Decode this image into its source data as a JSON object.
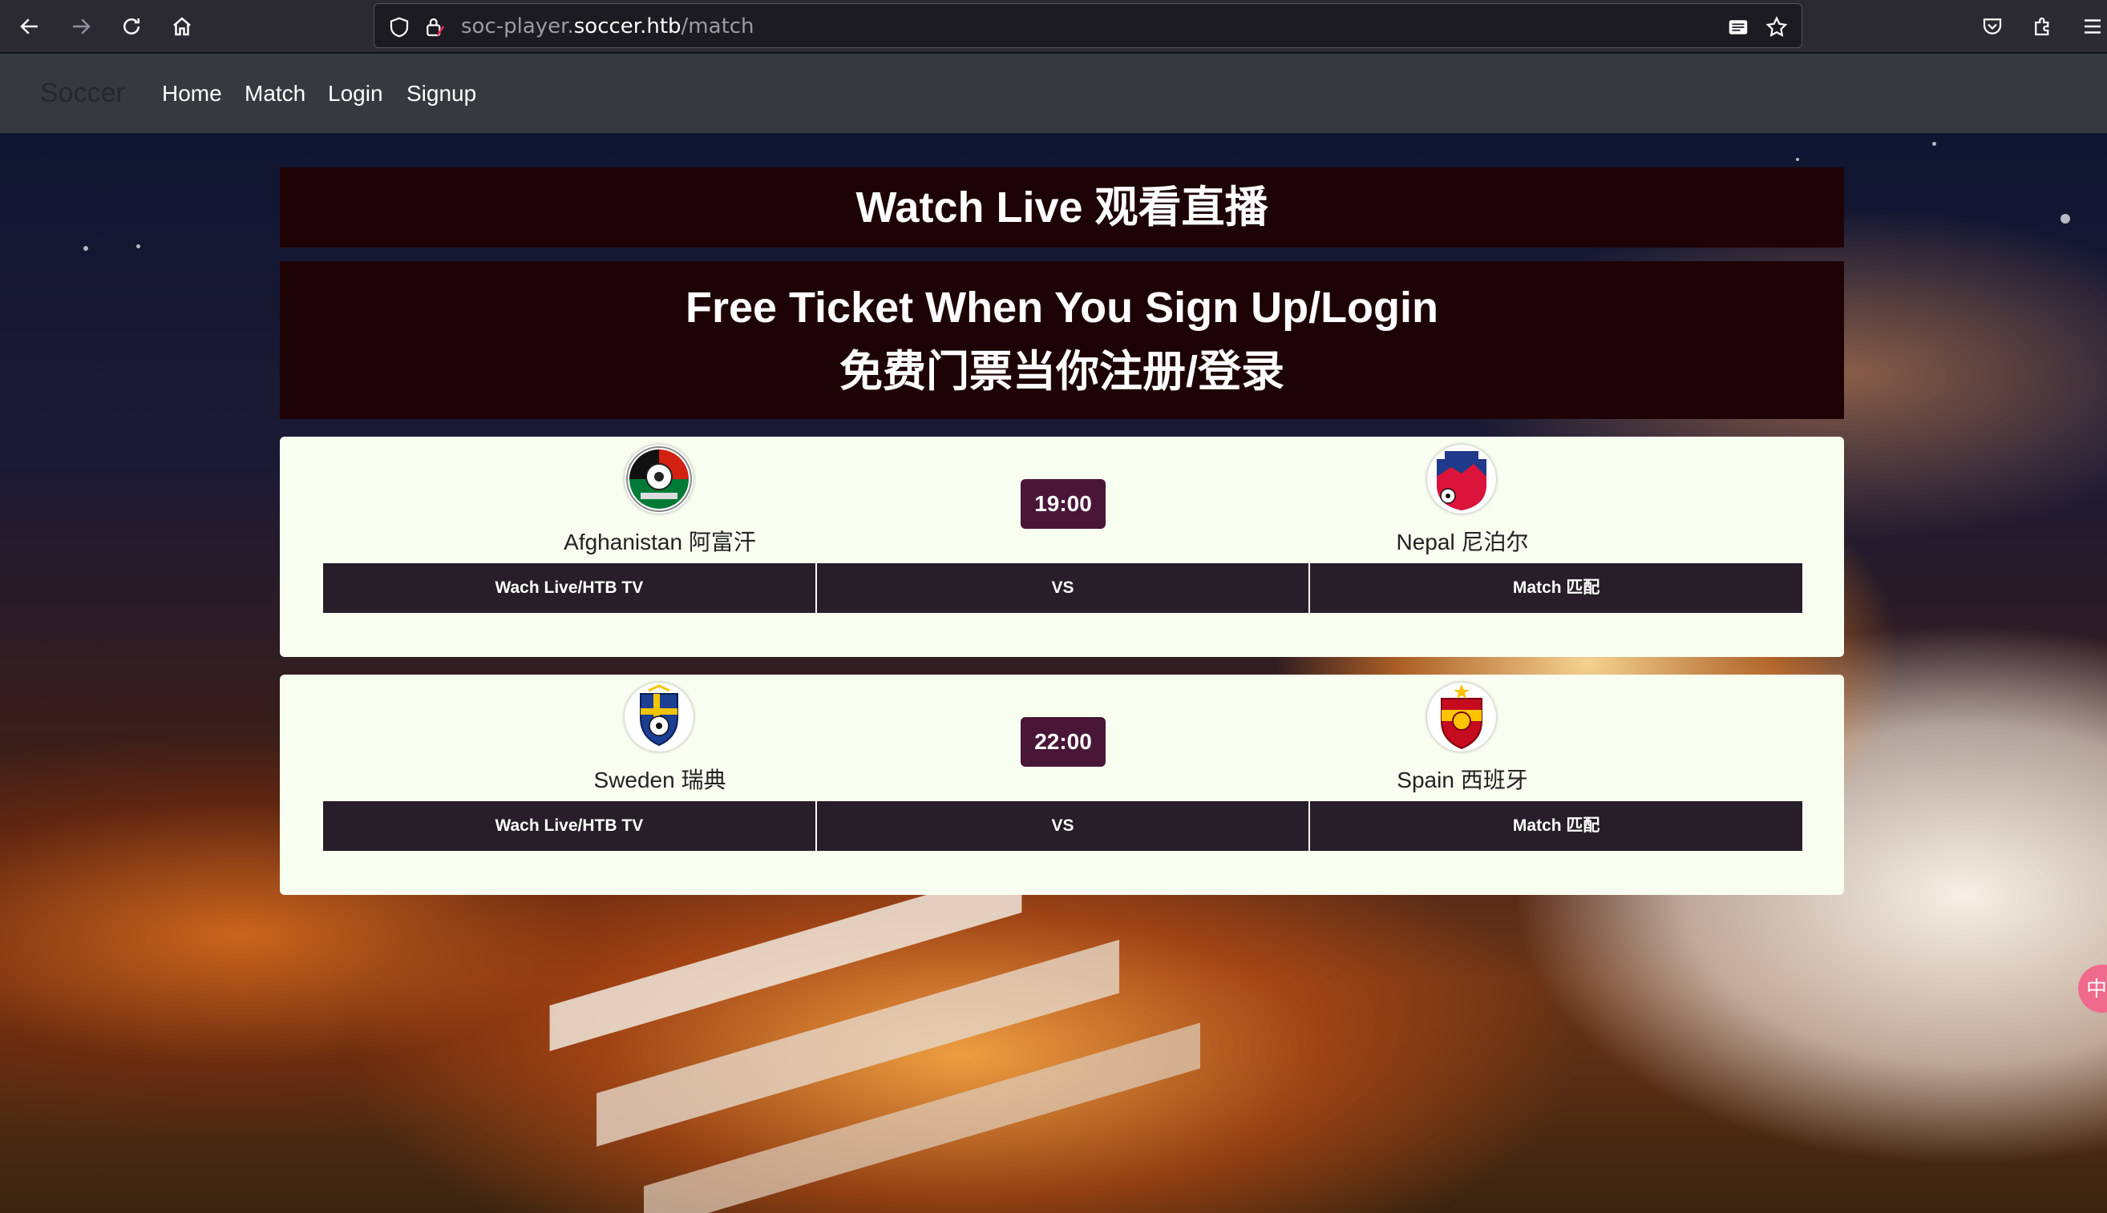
{
  "browser": {
    "url_prefix": "soc-player.",
    "url_domain": "soccer.htb",
    "url_path": "/match"
  },
  "navbar": {
    "brand": "Soccer",
    "links": [
      "Home",
      "Match",
      "Login",
      "Signup"
    ]
  },
  "banners": {
    "watch_live": "Watch Live 观看直播",
    "free_ticket_en": "Free Ticket When You Sign Up/Login",
    "free_ticket_zh": "免费门票当你注册/登录"
  },
  "matches": [
    {
      "home_team": "Afghanistan 阿富汗",
      "away_team": "Nepal 尼泊尔",
      "time": "19:00",
      "watch_label": "Wach Live/HTB TV",
      "vs_label": "VS",
      "match_label": "Match 匹配"
    },
    {
      "home_team": "Sweden 瑞典",
      "away_team": "Spain 西班牙",
      "time": "22:00",
      "watch_label": "Wach Live/HTB TV",
      "vs_label": "VS",
      "match_label": "Match 匹配"
    }
  ],
  "colors": {
    "banner_bg": "#1e0306",
    "card_bg": "#f8fef0",
    "time_badge": "#4a1638",
    "action_button": "#271e29",
    "navbar_bg": "#343a40"
  },
  "icons": {
    "back": "back-arrow-icon",
    "forward": "forward-arrow-icon",
    "reload": "reload-icon",
    "home": "home-icon",
    "shield": "shield-icon",
    "lock": "lock-icon",
    "reader": "reader-view-icon",
    "bookmark": "star-icon",
    "pocket": "pocket-icon",
    "extensions": "puzzle-icon",
    "menu": "hamburger-menu-icon"
  }
}
